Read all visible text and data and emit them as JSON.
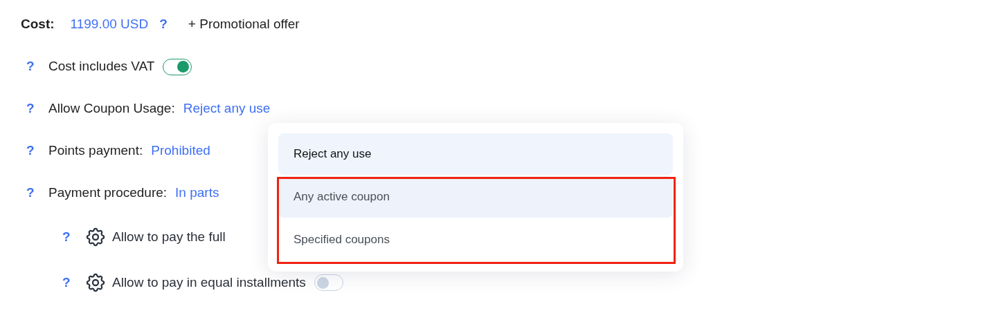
{
  "cost": {
    "label": "Cost:",
    "value": "1199.00 USD",
    "help": "?",
    "promo": "+ Promotional offer"
  },
  "settings": [
    {
      "kind": "toggle",
      "help": "?",
      "label": "Cost includes VAT",
      "on": true
    },
    {
      "kind": "select",
      "help": "?",
      "label": "Allow Coupon Usage:",
      "value": "Reject any use"
    },
    {
      "kind": "select",
      "help": "?",
      "label": "Points payment:",
      "value": "Prohibited"
    },
    {
      "kind": "select",
      "help": "?",
      "label": "Payment procedure:",
      "value": "In parts",
      "children": [
        {
          "kind": "text",
          "help": "?",
          "label": "Allow to pay the full"
        },
        {
          "kind": "toggle",
          "help": "?",
          "label": "Allow to pay in equal installments",
          "on": false
        }
      ]
    }
  ],
  "dropdown": {
    "highlighted": true,
    "options": [
      {
        "label": "Reject any use",
        "selected": true,
        "hovered": false
      },
      {
        "label": "Any active coupon",
        "selected": false,
        "hovered": true
      },
      {
        "label": "Specified coupons",
        "selected": false,
        "hovered": false
      }
    ]
  }
}
